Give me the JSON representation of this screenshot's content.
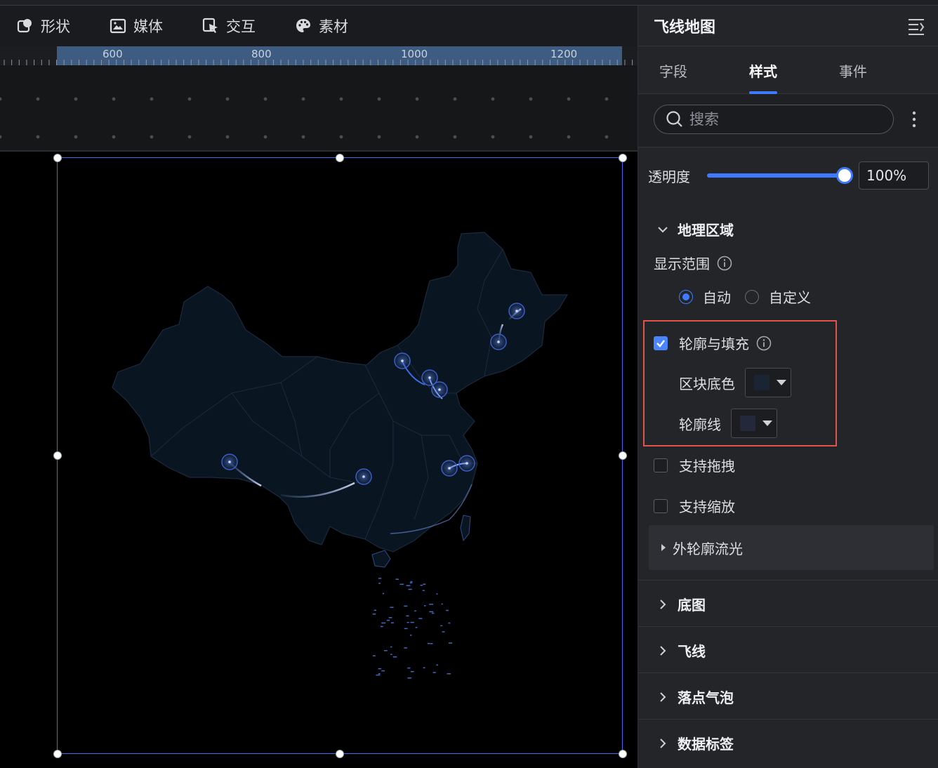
{
  "toolbar": {
    "items": [
      {
        "label": "形状",
        "icon": "shape-icon"
      },
      {
        "label": "媒体",
        "icon": "image-icon"
      },
      {
        "label": "交互",
        "icon": "cursor-icon"
      },
      {
        "label": "素材",
        "icon": "palette-icon"
      }
    ]
  },
  "ruler": {
    "labels": [
      "600",
      "800",
      "1000",
      "1200"
    ]
  },
  "panel": {
    "title": "飞线地图",
    "tabs": [
      "字段",
      "样式",
      "事件"
    ],
    "active_tab": "样式",
    "search_placeholder": "搜索",
    "opacity_label": "透明度",
    "opacity_value": "100%",
    "geo_section": "地理区域",
    "display_range_label": "显示范围",
    "radio_auto": "自动",
    "radio_custom": "自定义",
    "outline_fill_label": "轮廓与填充",
    "block_color_label": "区块底色",
    "outline_line_label": "轮廓线",
    "drag_label": "支持拖拽",
    "zoom_label": "支持缩放",
    "flow_label": "外轮廓流光",
    "sections": [
      "底图",
      "飞线",
      "落点气泡",
      "数据标签"
    ]
  },
  "colors": {
    "accent": "#3f7bff",
    "highlight_box": "#e0544a",
    "map_fill": "#0a1522",
    "block_color": "#1a2432",
    "outline_color": "#23283a"
  }
}
